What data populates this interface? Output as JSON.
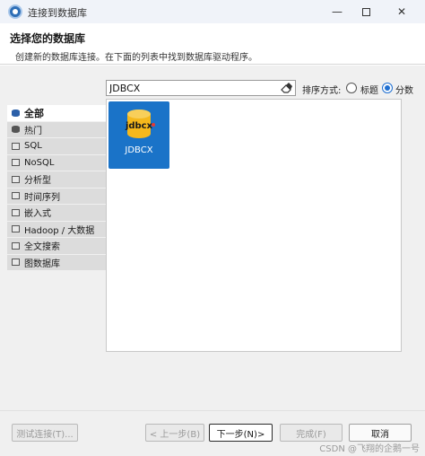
{
  "window": {
    "title": "连接到数据库",
    "controls": {
      "minimize": "—",
      "close": "✕"
    }
  },
  "header": {
    "title": "选择您的数据库",
    "subtitle": "创建新的数据库连接。在下面的列表中找到数据库驱动程序。"
  },
  "search": {
    "value": "JDBCX"
  },
  "sort": {
    "label": "排序方式:",
    "options": [
      {
        "label": "标题",
        "checked": false
      },
      {
        "label": "分数",
        "checked": true
      }
    ]
  },
  "categories": [
    {
      "label": "全部",
      "icon": "database-icon",
      "selected": true
    },
    {
      "label": "热门",
      "icon": "database-icon",
      "selected": false
    },
    {
      "label": "SQL",
      "icon": "folder-icon",
      "selected": false
    },
    {
      "label": "NoSQL",
      "icon": "folder-icon",
      "selected": false
    },
    {
      "label": "分析型",
      "icon": "folder-icon",
      "selected": false
    },
    {
      "label": "时间序列",
      "icon": "folder-icon",
      "selected": false
    },
    {
      "label": "嵌入式",
      "icon": "folder-icon",
      "selected": false
    },
    {
      "label": "Hadoop / 大数据",
      "icon": "folder-icon",
      "selected": false
    },
    {
      "label": "全文搜索",
      "icon": "folder-icon",
      "selected": false
    },
    {
      "label": "图数据库",
      "icon": "folder-icon",
      "selected": false
    }
  ],
  "drivers": [
    {
      "name": "JDBCX",
      "logo_text": "jdbcx",
      "selected": true
    }
  ],
  "buttons": {
    "test": "测试连接(T)...",
    "back": "< 上一步(B)",
    "next": "下一步(N)>",
    "finish": "完成(F)",
    "cancel": "取消"
  },
  "watermark": "CSDN @飞翔的企鹅一号",
  "colors": {
    "accent": "#1a73c8",
    "radio_checked": "#1f6fd1",
    "logo_yellow": "#f5b81c"
  }
}
